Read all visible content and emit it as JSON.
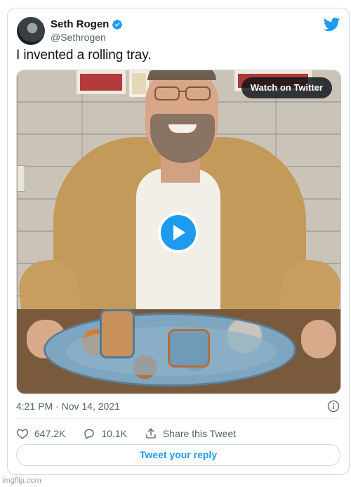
{
  "author": {
    "name": "Seth Rogen",
    "handle": "@Sethrogen",
    "verified": true,
    "avatar_icon": "avatar"
  },
  "tweet": {
    "text": "I invented a rolling tray.",
    "timestamp": "4:21 PM · Nov 14, 2021"
  },
  "media": {
    "watch_label": "Watch on Twitter",
    "play_icon": "play-icon"
  },
  "actions": {
    "likes": "647.2K",
    "replies": "10.1K",
    "share_label": "Share this Tweet"
  },
  "reply_button": {
    "label": "Tweet your reply"
  },
  "watermark": "imgflip.com",
  "colors": {
    "accent": "#1d9bf0",
    "text_primary": "#0f1419",
    "text_secondary": "#536471",
    "border": "#cfd9de"
  }
}
